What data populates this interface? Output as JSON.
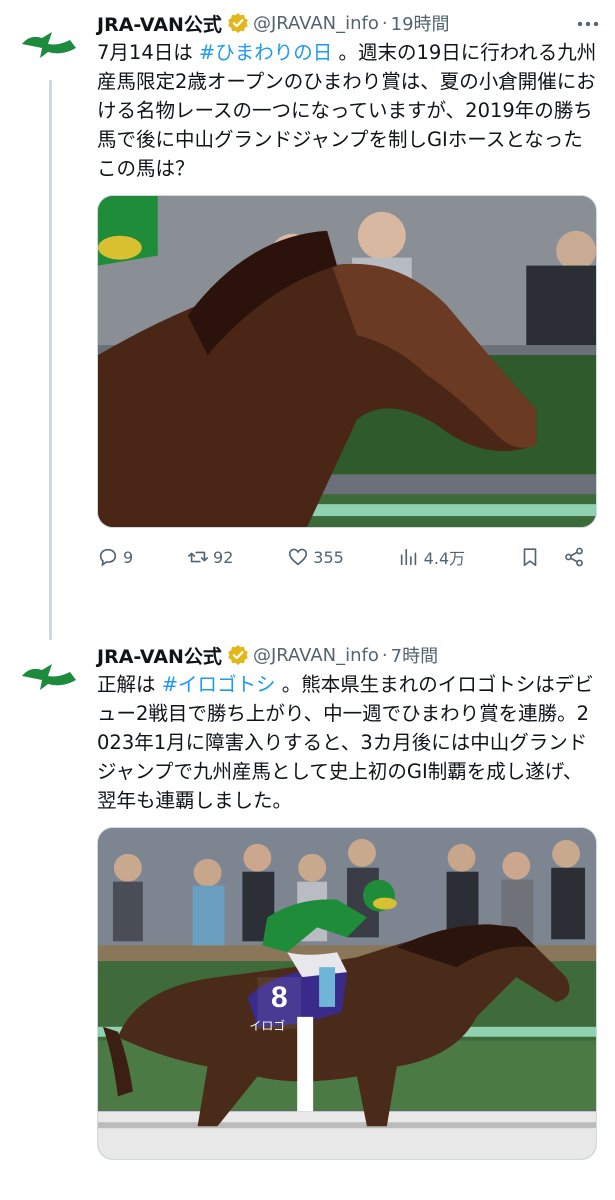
{
  "tweets": [
    {
      "display_name": "JRA-VAN公式",
      "handle": "@JRAVAN_info",
      "separator": "·",
      "time": "19時間",
      "text_before_hashtag": "7月14日は ",
      "hashtag": "#ひまわりの日",
      "text_after_hashtag": " 。週末の19日に行われる九州産馬限定2歳オープンのひまわり賞は、夏の小倉開催における名物レースの一つになっていますが、2019年の勝ち馬で後に中山グランドジャンプを制しGIホースとなったこの馬は？",
      "replies": "9",
      "reposts": "92",
      "likes": "355",
      "views": "4.4万"
    },
    {
      "display_name": "JRA-VAN公式",
      "handle": "@JRAVAN_info",
      "separator": "·",
      "time": "7時間",
      "text_before_hashtag": "正解は ",
      "hashtag": "#イロゴトシ",
      "text_after_hashtag": " 。熊本県生まれのイロゴトシはデビュー2戦目で勝ち上がり、中一週でひまわり賞を連勝。2023年1月に障害入りすると、3カ月後には中山グランドジャンプで九州産馬として史上初のGI制覇を成し遂げ、翌年も連覇しました。",
      "saddle_number": "8",
      "saddle_name": "イロゴ"
    }
  ],
  "colors": {
    "brand_green": "#1e8a3c",
    "verified_gold": "#e2b719",
    "link_blue": "#1d9bf0",
    "meta_gray": "#536471"
  },
  "icons": {
    "avatar": "jra-van-logo-icon",
    "verified": "verified-badge-icon",
    "more": "more-dots-icon",
    "reply": "reply-icon",
    "repost": "repost-icon",
    "like": "heart-icon",
    "views": "views-icon",
    "bookmark": "bookmark-icon",
    "share": "share-icon"
  }
}
